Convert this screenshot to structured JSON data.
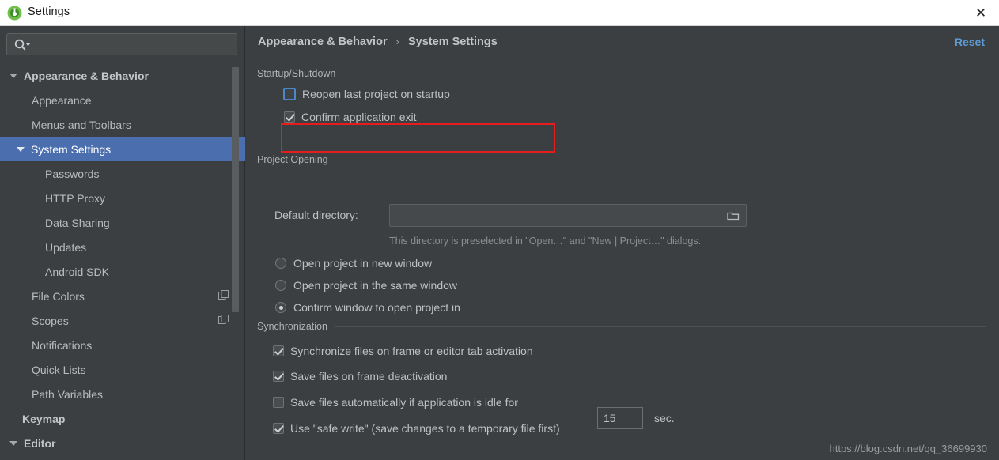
{
  "window": {
    "title": "Settings",
    "app_icon": "android-studio-icon",
    "close_label": "✕"
  },
  "search": {
    "value": "",
    "placeholder": "",
    "icon": "search-icon"
  },
  "sidebar": {
    "items": [
      {
        "label": "Appearance & Behavior",
        "level": 0,
        "expandable": true,
        "selected": false
      },
      {
        "label": "Appearance",
        "level": 1,
        "expandable": false,
        "selected": false
      },
      {
        "label": "Menus and Toolbars",
        "level": 1,
        "expandable": false,
        "selected": false
      },
      {
        "label": "System Settings",
        "level": 1,
        "expandable": true,
        "selected": true
      },
      {
        "label": "Passwords",
        "level": 2,
        "expandable": false,
        "selected": false
      },
      {
        "label": "HTTP Proxy",
        "level": 2,
        "expandable": false,
        "selected": false
      },
      {
        "label": "Data Sharing",
        "level": 2,
        "expandable": false,
        "selected": false
      },
      {
        "label": "Updates",
        "level": 2,
        "expandable": false,
        "selected": false
      },
      {
        "label": "Android SDK",
        "level": 2,
        "expandable": false,
        "selected": false
      },
      {
        "label": "File Colors",
        "level": 1,
        "expandable": false,
        "selected": false,
        "trailing_icon": "copy-icon"
      },
      {
        "label": "Scopes",
        "level": 1,
        "expandable": false,
        "selected": false,
        "trailing_icon": "copy-icon"
      },
      {
        "label": "Notifications",
        "level": 1,
        "expandable": false,
        "selected": false
      },
      {
        "label": "Quick Lists",
        "level": 1,
        "expandable": false,
        "selected": false
      },
      {
        "label": "Path Variables",
        "level": 1,
        "expandable": false,
        "selected": false
      },
      {
        "label": "Keymap",
        "level": 0,
        "expandable": false,
        "selected": false
      },
      {
        "label": "Editor",
        "level": 0,
        "expandable": true,
        "selected": false
      }
    ]
  },
  "header": {
    "breadcrumb_root": "Appearance & Behavior",
    "breadcrumb_sep": "›",
    "breadcrumb_leaf": "System Settings",
    "reset_label": "Reset"
  },
  "groups": {
    "startup": {
      "title": "Startup/Shutdown",
      "options": [
        {
          "label": "Reopen last project on startup",
          "checked": false,
          "focused": true,
          "annotated": true
        },
        {
          "label": "Confirm application exit",
          "checked": true,
          "focused": false,
          "annotated": false
        }
      ]
    },
    "project_opening": {
      "title": "Project Opening",
      "directory_label": "Default directory:",
      "directory_value": "",
      "directory_icon": "folder-icon",
      "hint": "This directory is preselected in \"Open…\" and \"New | Project…\" dialogs.",
      "radios": [
        {
          "label": "Open project in new window",
          "selected": false
        },
        {
          "label": "Open project in the same window",
          "selected": false
        },
        {
          "label": "Confirm window to open project in",
          "selected": true
        }
      ]
    },
    "synchronization": {
      "title": "Synchronization",
      "options": [
        {
          "label": "Synchronize files on frame or editor tab activation",
          "checked": true
        },
        {
          "label": "Save files on frame deactivation",
          "checked": true
        },
        {
          "label": "Save files automatically if application is idle for",
          "checked": false
        },
        {
          "label": "Use \"safe write\" (save changes to a temporary file first)",
          "checked": true
        }
      ],
      "idle_seconds": "15",
      "idle_unit": "sec."
    }
  },
  "watermark": "https://blog.csdn.net/qq_36699930",
  "colors": {
    "accent_selection": "#4b6eaf",
    "link": "#5c9bd6",
    "annotation": "#e71c1c",
    "panel_bg": "#3c3f41"
  }
}
